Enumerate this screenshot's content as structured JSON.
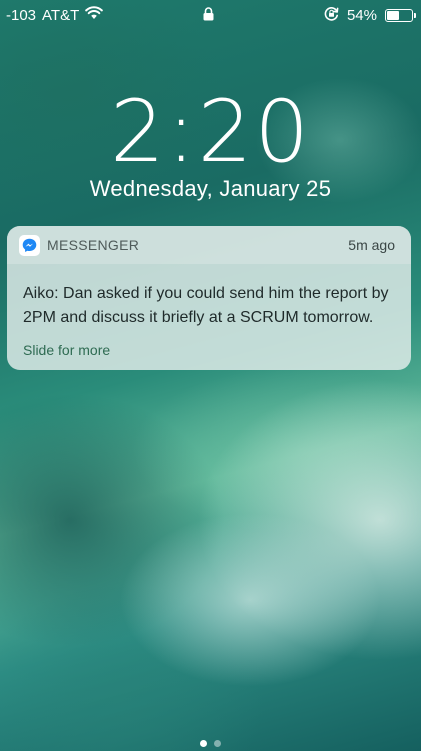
{
  "status_bar": {
    "signal": "-103",
    "carrier": "AT&T",
    "battery_percent": "54%",
    "battery_level": 0.54,
    "icons": [
      "wifi-icon",
      "lock-icon",
      "rotation-lock-icon",
      "battery-icon"
    ]
  },
  "lock_screen": {
    "time": "2:20",
    "date": "Wednesday, January 25"
  },
  "notification": {
    "app_name": "MESSENGER",
    "app_icon": "messenger-icon",
    "time_ago": "5m ago",
    "message": "Aiko: Dan asked if you could send him the report by 2PM and discuss it briefly at a SCRUM tomorrow.",
    "action_hint": "Slide for more",
    "accent_color": "#2e6b52"
  },
  "page_indicator": {
    "pages": 2,
    "active_page": 1
  }
}
